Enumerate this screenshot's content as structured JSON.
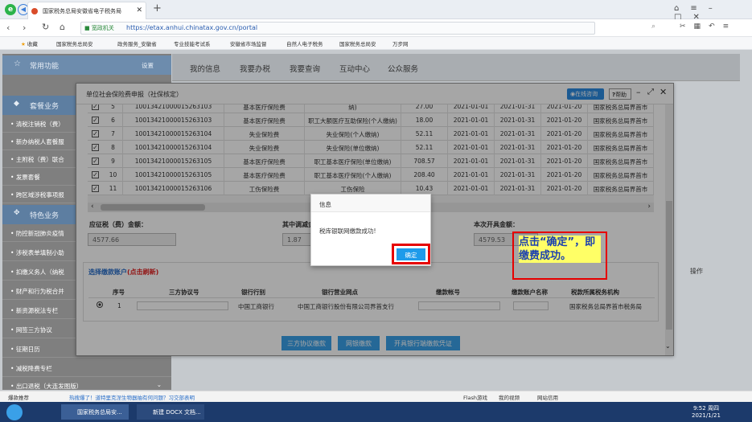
{
  "browser": {
    "tab_title": "国家税务总局安徽省电子税务局",
    "new_tab": "+",
    "secure_label": "宽政机关",
    "url": "https://etax.anhui.chinatax.gov.cn/portal",
    "bookmarks": [
      "收藏",
      "国家税务总局安",
      "政务服务_安徽省",
      "专业技能考试系",
      "安徽省市场监督",
      "自然人电子税务",
      "国家税务总局安",
      "万步网"
    ]
  },
  "sidebar": {
    "common_label": "常用功能",
    "settings_label": "设置",
    "section1": "套餐业务",
    "items1": [
      "清税注销税（费）",
      "新办纳税人套餐服",
      "主附税（费）联合",
      "发票套餐",
      "跨区域涉税事项报"
    ],
    "section2": "特色业务",
    "items2": [
      "防控新冠肺炎疫情",
      "涉税表单填制小助",
      "扣缴义务人（纳税",
      "财产和行为税合并",
      "新资源税法专栏",
      "网签三方协议",
      "征期日历",
      "减税降费专栏",
      "出口退税（大连发图版）"
    ]
  },
  "topnav": [
    "我的信息",
    "我要办税",
    "我要查询",
    "互动中心",
    "公众服务"
  ],
  "dialog": {
    "title": "单位社会保险费申报（社保核定）",
    "online_help": "在线咨询",
    "help": "帮助",
    "rows": [
      {
        "seq": "5",
        "code": "100134210000152631​03",
        "type": "基本医疗保险费",
        "item": "纳)",
        "amount": "27.00",
        "start": "2021-01-01",
        "end": "2021-01-31",
        "date": "2021-01-20",
        "org": "国家税务总局界首市"
      },
      {
        "seq": "6",
        "code": "1001342100001526310​3",
        "type": "基本医疗保险费",
        "item": "职工大额医疗互助保险(个人缴纳)",
        "amount": "18.00",
        "start": "2021-01-01",
        "end": "2021-01-31",
        "date": "2021-01-20",
        "org": "国家税务总局界首市"
      },
      {
        "seq": "7",
        "code": "10013421000015263104",
        "type": "失业保险费",
        "item": "失业保险(个人缴纳)",
        "amount": "52.11",
        "start": "2021-01-01",
        "end": "2021-01-31",
        "date": "2021-01-20",
        "org": "国家税务总局界首市"
      },
      {
        "seq": "8",
        "code": "10013421000015263104",
        "type": "失业保险费",
        "item": "失业保险(单位缴纳)",
        "amount": "52.11",
        "start": "2021-01-01",
        "end": "2021-01-31",
        "date": "2021-01-20",
        "org": "国家税务总局界首市"
      },
      {
        "seq": "9",
        "code": "10013421000015263105",
        "type": "基本医疗保险费",
        "item": "职工基本医疗保险(单位缴纳)",
        "amount": "708.57",
        "start": "2021-01-01",
        "end": "2021-01-31",
        "date": "2021-01-20",
        "org": "国家税务总局界首市"
      },
      {
        "seq": "10",
        "code": "10013421000015263105",
        "type": "基本医疗保险费",
        "item": "职工基本医疗保险(个人缴纳)",
        "amount": "208.40",
        "start": "2021-01-01",
        "end": "2021-01-31",
        "date": "2021-01-20",
        "org": "国家税务总局界首市"
      },
      {
        "seq": "11",
        "code": "10013421000015263106",
        "type": "工伤保险费",
        "item": "工伤保险",
        "amount": "10.43",
        "start": "2021-01-01",
        "end": "2021-01-31",
        "date": "2021-01-20",
        "org": "国家税务总局界首市"
      }
    ],
    "amount_label": "应征税（费）金额：",
    "amount_value": "4577.66",
    "reduce_label": "其中调减金",
    "reduce_value": "1.87",
    "paid_label": "本次开具金额：",
    "paid_value": "4579.53",
    "select_account": "选择缴款账户",
    "refresh": "(点击刷新)",
    "acct_headers": [
      "序号",
      "三方协议号",
      "银行行别",
      "银行营业网点",
      "缴款帐号",
      "缴款账户名称",
      "税款所属税务机构"
    ],
    "acct_row": {
      "seq": "1",
      "bank": "中国工商银行",
      "branch": "中国工商银行股份有限公司界首支行",
      "org": "国家税务总局界首市税务局"
    },
    "buttons": [
      "三方协议缴款",
      "网银缴款",
      "开具银行端缴款凭证"
    ],
    "operate": "操作"
  },
  "message": {
    "title": "信息",
    "text": "税库银联网缴款成功!",
    "ok": "确定"
  },
  "annotation": "点击“确定”，即缴费成功。",
  "status": {
    "left": "爆款推荐",
    "news": "热搜爆了！道特里克涅生物器抽有何问题？习交部表明",
    "flash": "Flash游戏",
    "video": "我的视频",
    "net": "网站信用"
  },
  "taskbar": {
    "app1": "国家税务总局安...",
    "app2": "新建 DOCX 文档...",
    "time": "9:52 周四",
    "date": "2021/1/21"
  }
}
